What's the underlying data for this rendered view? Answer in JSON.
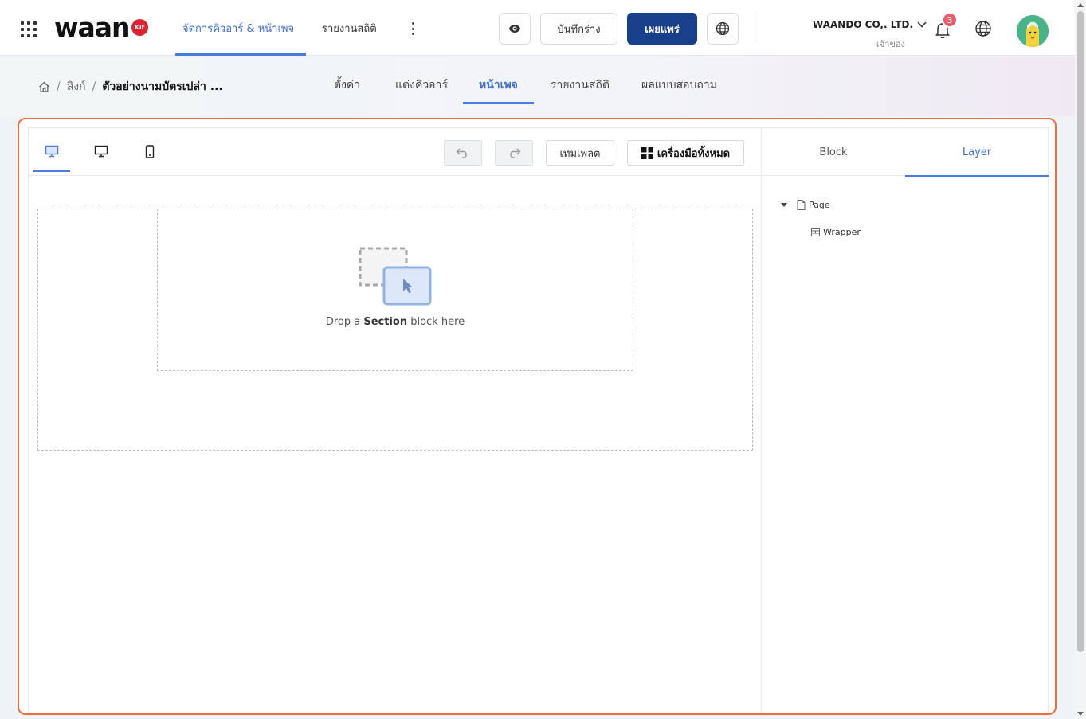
{
  "header": {
    "logo_text": "waan",
    "logo_badge": "Kit",
    "nav": [
      {
        "label": "จัดการคิวอาร์ & หน้าเพจ",
        "active": true
      },
      {
        "label": "รายงานสถิติ",
        "active": false
      }
    ],
    "preview_icon": "eye-icon",
    "save_draft_label": "บันทึกร่าง",
    "publish_label": "เผยแพร่",
    "language_icon": "globe-icon",
    "company_name": "WAANDO CO,. LTD.",
    "company_role": "เจ้าของ",
    "notification_count": "3",
    "accent_color": "#4a7be0",
    "publish_color": "#173f8a"
  },
  "breadcrumb": {
    "home_icon": "home-icon",
    "parent": "ลิงก์",
    "current": "ตัวอย่างนามบัตรเปล่า ..."
  },
  "page_tabs": [
    {
      "label": "ตั้งค่า",
      "active": false
    },
    {
      "label": "แต่งคิวอาร์",
      "active": false
    },
    {
      "label": "หน้าเพจ",
      "active": true
    },
    {
      "label": "รายงานสถิติ",
      "active": false
    },
    {
      "label": "ผลแบบสอบถาม",
      "active": false
    }
  ],
  "editor": {
    "devices": [
      "desktop-wide-icon",
      "desktop-icon",
      "mobile-icon"
    ],
    "undo_icon": "undo-icon",
    "redo_icon": "redo-icon",
    "template_label": "เทมเพลต",
    "all_tools_label": "เครื่องมือทั้งหมด",
    "drop_prefix": "Drop a ",
    "drop_strong": "Section",
    "drop_suffix": " block here",
    "frame_color": "#f06d3a"
  },
  "panel": {
    "tabs": [
      {
        "label": "Block",
        "active": false
      },
      {
        "label": "Layer",
        "active": true
      }
    ],
    "tree": [
      {
        "label": "Page",
        "icon": "page-icon",
        "level": 0,
        "expanded": true
      },
      {
        "label": "Wrapper",
        "icon": "wrapper-icon",
        "level": 1
      }
    ]
  }
}
